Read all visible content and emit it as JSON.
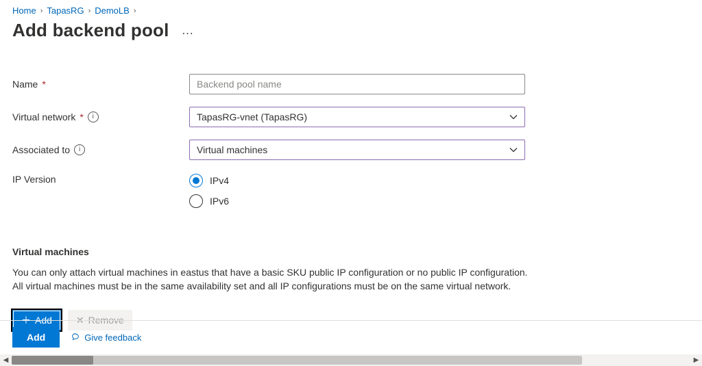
{
  "breadcrumb": {
    "items": [
      {
        "label": "Home"
      },
      {
        "label": "TapasRG"
      },
      {
        "label": "DemoLB"
      }
    ]
  },
  "page": {
    "title": "Add backend pool",
    "more_label": "…"
  },
  "form": {
    "name": {
      "label": "Name",
      "required": true,
      "value": "",
      "placeholder": "Backend pool name"
    },
    "vnet": {
      "label": "Virtual network",
      "required": true,
      "info": true,
      "selected": "TapasRG-vnet (TapasRG)"
    },
    "associated_to": {
      "label": "Associated to",
      "info": true,
      "selected": "Virtual machines"
    },
    "ip_version": {
      "label": "IP Version",
      "selected": "ipv4",
      "options": {
        "ipv4": "IPv4",
        "ipv6": "IPv6"
      }
    }
  },
  "vm_section": {
    "heading": "Virtual machines",
    "description": "You can only attach virtual machines in eastus that have a basic SKU public IP configuration or no public IP configuration. All virtual machines must be in the same availability set and all IP configurations must be on the same virtual network.",
    "add_label": "Add",
    "remove_label": "Remove"
  },
  "footer": {
    "submit_label": "Add",
    "feedback_label": "Give feedback"
  }
}
